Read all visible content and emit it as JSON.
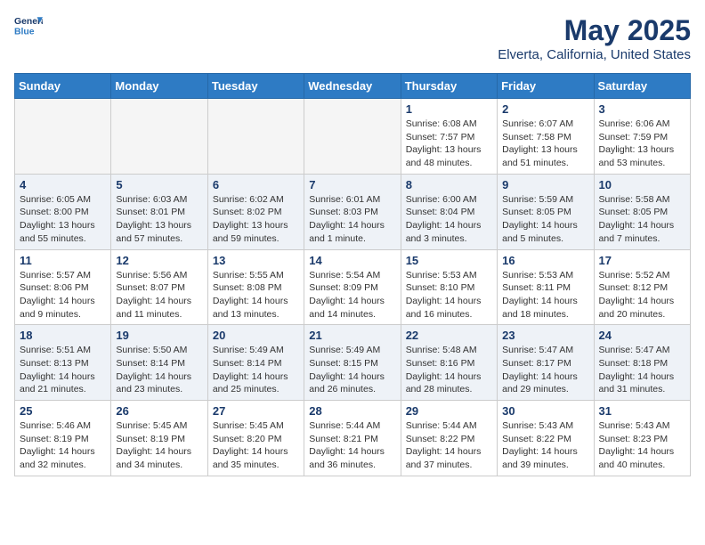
{
  "header": {
    "logo_line1": "General",
    "logo_line2": "Blue",
    "title": "May 2025",
    "subtitle": "Elverta, California, United States"
  },
  "weekdays": [
    "Sunday",
    "Monday",
    "Tuesday",
    "Wednesday",
    "Thursday",
    "Friday",
    "Saturday"
  ],
  "weeks": [
    [
      {
        "day": "",
        "info": ""
      },
      {
        "day": "",
        "info": ""
      },
      {
        "day": "",
        "info": ""
      },
      {
        "day": "",
        "info": ""
      },
      {
        "day": "1",
        "info": "Sunrise: 6:08 AM\nSunset: 7:57 PM\nDaylight: 13 hours\nand 48 minutes."
      },
      {
        "day": "2",
        "info": "Sunrise: 6:07 AM\nSunset: 7:58 PM\nDaylight: 13 hours\nand 51 minutes."
      },
      {
        "day": "3",
        "info": "Sunrise: 6:06 AM\nSunset: 7:59 PM\nDaylight: 13 hours\nand 53 minutes."
      }
    ],
    [
      {
        "day": "4",
        "info": "Sunrise: 6:05 AM\nSunset: 8:00 PM\nDaylight: 13 hours\nand 55 minutes."
      },
      {
        "day": "5",
        "info": "Sunrise: 6:03 AM\nSunset: 8:01 PM\nDaylight: 13 hours\nand 57 minutes."
      },
      {
        "day": "6",
        "info": "Sunrise: 6:02 AM\nSunset: 8:02 PM\nDaylight: 13 hours\nand 59 minutes."
      },
      {
        "day": "7",
        "info": "Sunrise: 6:01 AM\nSunset: 8:03 PM\nDaylight: 14 hours\nand 1 minute."
      },
      {
        "day": "8",
        "info": "Sunrise: 6:00 AM\nSunset: 8:04 PM\nDaylight: 14 hours\nand 3 minutes."
      },
      {
        "day": "9",
        "info": "Sunrise: 5:59 AM\nSunset: 8:05 PM\nDaylight: 14 hours\nand 5 minutes."
      },
      {
        "day": "10",
        "info": "Sunrise: 5:58 AM\nSunset: 8:05 PM\nDaylight: 14 hours\nand 7 minutes."
      }
    ],
    [
      {
        "day": "11",
        "info": "Sunrise: 5:57 AM\nSunset: 8:06 PM\nDaylight: 14 hours\nand 9 minutes."
      },
      {
        "day": "12",
        "info": "Sunrise: 5:56 AM\nSunset: 8:07 PM\nDaylight: 14 hours\nand 11 minutes."
      },
      {
        "day": "13",
        "info": "Sunrise: 5:55 AM\nSunset: 8:08 PM\nDaylight: 14 hours\nand 13 minutes."
      },
      {
        "day": "14",
        "info": "Sunrise: 5:54 AM\nSunset: 8:09 PM\nDaylight: 14 hours\nand 14 minutes."
      },
      {
        "day": "15",
        "info": "Sunrise: 5:53 AM\nSunset: 8:10 PM\nDaylight: 14 hours\nand 16 minutes."
      },
      {
        "day": "16",
        "info": "Sunrise: 5:53 AM\nSunset: 8:11 PM\nDaylight: 14 hours\nand 18 minutes."
      },
      {
        "day": "17",
        "info": "Sunrise: 5:52 AM\nSunset: 8:12 PM\nDaylight: 14 hours\nand 20 minutes."
      }
    ],
    [
      {
        "day": "18",
        "info": "Sunrise: 5:51 AM\nSunset: 8:13 PM\nDaylight: 14 hours\nand 21 minutes."
      },
      {
        "day": "19",
        "info": "Sunrise: 5:50 AM\nSunset: 8:14 PM\nDaylight: 14 hours\nand 23 minutes."
      },
      {
        "day": "20",
        "info": "Sunrise: 5:49 AM\nSunset: 8:14 PM\nDaylight: 14 hours\nand 25 minutes."
      },
      {
        "day": "21",
        "info": "Sunrise: 5:49 AM\nSunset: 8:15 PM\nDaylight: 14 hours\nand 26 minutes."
      },
      {
        "day": "22",
        "info": "Sunrise: 5:48 AM\nSunset: 8:16 PM\nDaylight: 14 hours\nand 28 minutes."
      },
      {
        "day": "23",
        "info": "Sunrise: 5:47 AM\nSunset: 8:17 PM\nDaylight: 14 hours\nand 29 minutes."
      },
      {
        "day": "24",
        "info": "Sunrise: 5:47 AM\nSunset: 8:18 PM\nDaylight: 14 hours\nand 31 minutes."
      }
    ],
    [
      {
        "day": "25",
        "info": "Sunrise: 5:46 AM\nSunset: 8:19 PM\nDaylight: 14 hours\nand 32 minutes."
      },
      {
        "day": "26",
        "info": "Sunrise: 5:45 AM\nSunset: 8:19 PM\nDaylight: 14 hours\nand 34 minutes."
      },
      {
        "day": "27",
        "info": "Sunrise: 5:45 AM\nSunset: 8:20 PM\nDaylight: 14 hours\nand 35 minutes."
      },
      {
        "day": "28",
        "info": "Sunrise: 5:44 AM\nSunset: 8:21 PM\nDaylight: 14 hours\nand 36 minutes."
      },
      {
        "day": "29",
        "info": "Sunrise: 5:44 AM\nSunset: 8:22 PM\nDaylight: 14 hours\nand 37 minutes."
      },
      {
        "day": "30",
        "info": "Sunrise: 5:43 AM\nSunset: 8:22 PM\nDaylight: 14 hours\nand 39 minutes."
      },
      {
        "day": "31",
        "info": "Sunrise: 5:43 AM\nSunset: 8:23 PM\nDaylight: 14 hours\nand 40 minutes."
      }
    ]
  ]
}
